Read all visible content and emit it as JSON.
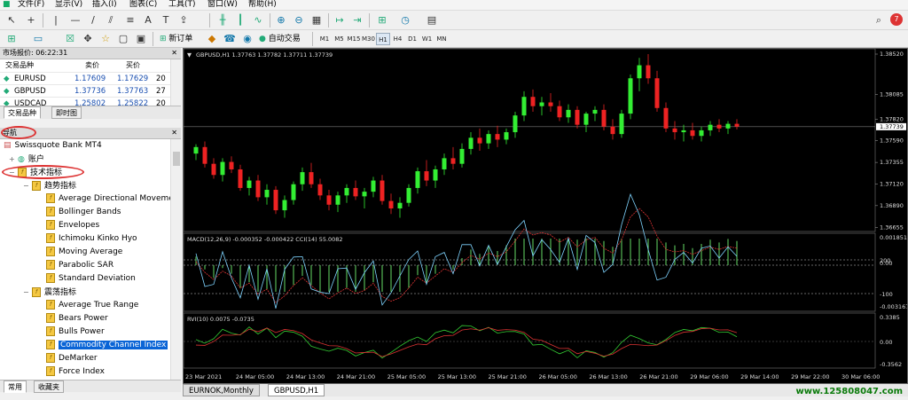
{
  "menu": [
    "文件(F)",
    "显示(V)",
    "插入(I)",
    "图表(C)",
    "工具(T)",
    "窗口(W)",
    "帮助(H)"
  ],
  "toolbar": {
    "new_order": "新订单",
    "auto_trade": "自动交易",
    "timeframes": [
      "M1",
      "M5",
      "M15",
      "M30",
      "H1",
      "H4",
      "D1",
      "W1",
      "MN"
    ],
    "active_timeframe": "H1",
    "notifications": "7"
  },
  "market_watch": {
    "title": "市场报价: 06:22:31",
    "headers": [
      "交易品种",
      "卖价",
      "买价",
      ""
    ],
    "rows": [
      {
        "symbol": "EURUSD",
        "bid": "1.17609",
        "ask": "1.17629",
        "spread": "20"
      },
      {
        "symbol": "GBPUSD",
        "bid": "1.37736",
        "ask": "1.37763",
        "spread": "27"
      },
      {
        "symbol": "USDCAD",
        "bid": "1.25802",
        "ask": "1.25822",
        "spread": "20"
      }
    ],
    "tabs": [
      "交易品种",
      "即时图"
    ]
  },
  "navigator": {
    "title": "导航",
    "broker": "Swissquote Bank MT4",
    "accounts": "账户",
    "indicators": "技术指标",
    "trend_group": "趋势指标",
    "trend_items": [
      "Average Directional Movement Index",
      "Bollinger Bands",
      "Envelopes",
      "Ichimoku Kinko Hyo",
      "Moving Average",
      "Parabolic SAR",
      "Standard Deviation"
    ],
    "osc_group": "震荡指标",
    "osc_items": [
      "Average True Range",
      "Bears Power",
      "Bulls Power",
      "Commodity Channel Index",
      "DeMarker",
      "Force Index"
    ],
    "selected_item": "Commodity Channel Index",
    "tabs": [
      "常用",
      "收藏夹"
    ]
  },
  "chart": {
    "header": "GBPUSD,H1  1.37763 1.37782 1.37711 1.37739",
    "macd_label": "MACD(12,26,9) -0.000352 -0.000422  CCI(14) 55.0082",
    "rvi_label": "RVI(10) 0.0075 -0.0735",
    "price_axis": [
      "1.38520",
      "1.38085",
      "1.37820",
      "1.37590",
      "1.37355",
      "1.37120",
      "1.36890",
      "1.36655"
    ],
    "current_price": "1.37739",
    "macd_axis": [
      "0.001851",
      "200",
      "0.00",
      "-100",
      "-0.003167"
    ],
    "cci_axis": [
      "100"
    ],
    "rvi_axis": [
      "0.3385",
      "0.00",
      "-0.3562"
    ],
    "time_axis": [
      "23 Mar 2021",
      "24 Mar 05:00",
      "24 Mar 13:00",
      "24 Mar 21:00",
      "25 Mar 05:00",
      "25 Mar 13:00",
      "25 Mar 21:00",
      "26 Mar 05:00",
      "26 Mar 13:00",
      "26 Mar 21:00",
      "29 Mar 06:00",
      "29 Mar 14:00",
      "29 Mar 22:00",
      "30 Mar 06:00"
    ],
    "tabs": [
      "EURNOK,Monthly",
      "GBPUSD,H1"
    ],
    "active_tab": "GBPUSD,H1",
    "candles": [
      [
        1.3745,
        1.3755,
        1.3738,
        1.3752
      ],
      [
        1.3752,
        1.3758,
        1.373,
        1.3734
      ],
      [
        1.3734,
        1.374,
        1.3718,
        1.3722
      ],
      [
        1.3722,
        1.374,
        1.3715,
        1.3736
      ],
      [
        1.3736,
        1.3742,
        1.3724,
        1.3728
      ],
      [
        1.3728,
        1.3733,
        1.3705,
        1.3708
      ],
      [
        1.3708,
        1.372,
        1.37,
        1.3716
      ],
      [
        1.3716,
        1.3722,
        1.3694,
        1.3698
      ],
      [
        1.3698,
        1.3712,
        1.369,
        1.3706
      ],
      [
        1.3706,
        1.371,
        1.368,
        1.3684
      ],
      [
        1.3684,
        1.37,
        1.3676,
        1.3695
      ],
      [
        1.3695,
        1.3715,
        1.369,
        1.3712
      ],
      [
        1.3712,
        1.373,
        1.3705,
        1.3725
      ],
      [
        1.3725,
        1.3735,
        1.3708,
        1.3712
      ],
      [
        1.3712,
        1.3718,
        1.3695,
        1.37
      ],
      [
        1.37,
        1.3706,
        1.3684,
        1.369
      ],
      [
        1.369,
        1.3704,
        1.3682,
        1.37
      ],
      [
        1.37,
        1.3712,
        1.3692,
        1.3708
      ],
      [
        1.3708,
        1.3716,
        1.3695,
        1.3699
      ],
      [
        1.3699,
        1.3708,
        1.3686,
        1.3704
      ],
      [
        1.3704,
        1.372,
        1.3698,
        1.3716
      ],
      [
        1.3716,
        1.3722,
        1.369,
        1.3694
      ],
      [
        1.3694,
        1.3702,
        1.368,
        1.3686
      ],
      [
        1.3686,
        1.3698,
        1.3676,
        1.3692
      ],
      [
        1.3692,
        1.3712,
        1.3688,
        1.3708
      ],
      [
        1.3708,
        1.373,
        1.3702,
        1.3726
      ],
      [
        1.3726,
        1.3738,
        1.371,
        1.3716
      ],
      [
        1.3716,
        1.3732,
        1.3708,
        1.3728
      ],
      [
        1.3728,
        1.3745,
        1.3722,
        1.374
      ],
      [
        1.374,
        1.3752,
        1.3728,
        1.3734
      ],
      [
        1.3734,
        1.3756,
        1.373,
        1.375
      ],
      [
        1.375,
        1.3768,
        1.3744,
        1.3762
      ],
      [
        1.3762,
        1.3772,
        1.3748,
        1.3756
      ],
      [
        1.3756,
        1.377,
        1.375,
        1.3766
      ],
      [
        1.3766,
        1.3775,
        1.3752,
        1.376
      ],
      [
        1.376,
        1.3772,
        1.3755,
        1.3768
      ],
      [
        1.3768,
        1.379,
        1.3762,
        1.3786
      ],
      [
        1.3786,
        1.3812,
        1.378,
        1.3806
      ],
      [
        1.3806,
        1.3814,
        1.379,
        1.3796
      ],
      [
        1.3796,
        1.3806,
        1.3786,
        1.38
      ],
      [
        1.38,
        1.381,
        1.379,
        1.3796
      ],
      [
        1.3796,
        1.3802,
        1.378,
        1.3784
      ],
      [
        1.3784,
        1.3798,
        1.3778,
        1.3792
      ],
      [
        1.3792,
        1.3796,
        1.3772,
        1.3776
      ],
      [
        1.3776,
        1.379,
        1.3768,
        1.3788
      ],
      [
        1.3788,
        1.3796,
        1.378,
        1.3792
      ],
      [
        1.3792,
        1.3798,
        1.377,
        1.3774
      ],
      [
        1.3774,
        1.3782,
        1.376,
        1.3766
      ],
      [
        1.3766,
        1.3792,
        1.3762,
        1.3788
      ],
      [
        1.3788,
        1.383,
        1.3782,
        1.3826
      ],
      [
        1.3826,
        1.3848,
        1.3812,
        1.384
      ],
      [
        1.384,
        1.3852,
        1.382,
        1.3826
      ],
      [
        1.3826,
        1.3834,
        1.379,
        1.3794
      ],
      [
        1.3794,
        1.38,
        1.3768,
        1.3772
      ],
      [
        1.3772,
        1.378,
        1.376,
        1.3768
      ],
      [
        1.3768,
        1.3776,
        1.3758,
        1.377
      ],
      [
        1.377,
        1.3778,
        1.376,
        1.3764
      ],
      [
        1.3764,
        1.3774,
        1.3758,
        1.377
      ],
      [
        1.377,
        1.378,
        1.3764,
        1.3776
      ],
      [
        1.3776,
        1.3782,
        1.3768,
        1.3772
      ],
      [
        1.3772,
        1.378,
        1.3766,
        1.3777
      ],
      [
        1.3777,
        1.3782,
        1.3771,
        1.3774
      ]
    ]
  },
  "watermark": "www.125808047.com",
  "colors": {
    "bull": "#33ee33",
    "bear": "#ee2222",
    "accent": "#0a64d6",
    "annotation": "#d33333"
  }
}
